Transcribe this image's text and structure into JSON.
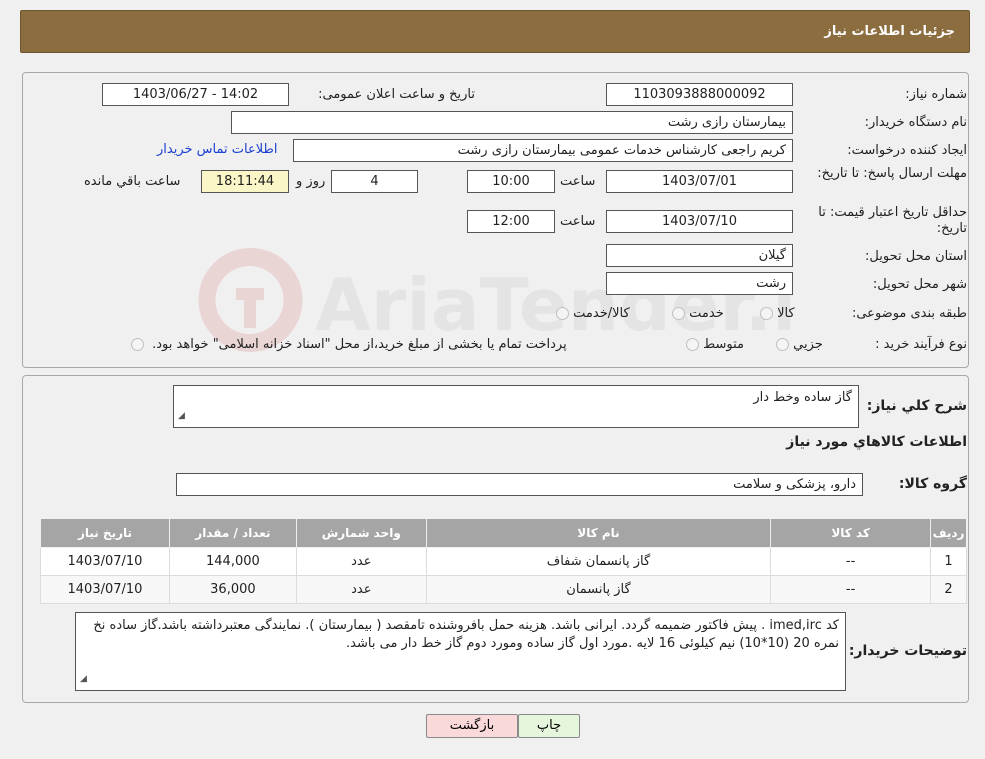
{
  "page_title": "جزئیات اطلاعات نیاز",
  "labels": {
    "need_number": "شماره نیاز:",
    "announce_datetime": "تاریخ و ساعت اعلان عمومی:",
    "buyer_org": "نام دستگاه خریدار:",
    "requester": "ایجاد کننده درخواست:",
    "contact_link": "اطلاعات تماس خریدار",
    "reply_deadline": "مهلت ارسال پاسخ: تا تاریخ:",
    "time_word": "ساعت",
    "day_and": "روز و",
    "remaining": "ساعت باقي مانده",
    "price_validity": "حداقل تاریخ اعتبار قیمت: تا تاریخ:",
    "province": "استان محل تحویل:",
    "city": "شهر محل تحویل:",
    "category": "طبقه بندی موضوعی:",
    "process_type": "نوع فرآیند خرید :",
    "summary": "شرح كلي نياز:",
    "goods_info_heading": "اطلاعات كالاهاي مورد نياز",
    "goods_group": "گروه كالا:",
    "buyer_notes": "توضیحات خریدار:"
  },
  "fields": {
    "need_number": "1103093888000092",
    "announce_datetime": "1403/06/27 - 14:02",
    "buyer_org": "بیمارستان رازی رشت",
    "requester": "کریم راجعی کارشناس خدمات عمومی بیمارستان رازی رشت",
    "reply_date": "1403/07/01",
    "reply_time": "10:00",
    "days_left": "4",
    "time_left": "18:11:44",
    "validity_date": "1403/07/10",
    "validity_time": "12:00",
    "province": "گیلان",
    "city": "رشت",
    "summary": "گاز ساده وخط دار",
    "goods_group": "دارو، پزشکی و سلامت",
    "buyer_notes": "کد imed,irc . پیش فاکتور ضمیمه گردد. ایرانی باشد. هزینه حمل بافروشنده تامقصد ( بیمارستان ). نمایندگی معتبرداشته باشد.گاز ساده نخ نمره 20 (10*10) نیم کیلوئی 16 لایه .مورد اول گاز ساده ومورد دوم گاز خط دار می باشد."
  },
  "category_options": [
    "كالا",
    "خدمت",
    "كالا/خدمت"
  ],
  "process_options": [
    "جزيي",
    "متوسط"
  ],
  "process_note": "پرداخت تمام یا بخشی از مبلغ خرید،از محل \"اسناد خزانه اسلامی\" خواهد بود.",
  "table": {
    "headers": [
      "رديف",
      "كد كالا",
      "نام كالا",
      "واحد شمارش",
      "تعداد / مقدار",
      "تاریخ نیاز"
    ],
    "rows": [
      [
        "1",
        "--",
        "گاز پانسمان شفاف",
        "عدد",
        "144,000",
        "1403/07/10"
      ],
      [
        "2",
        "--",
        "گاز پانسمان",
        "عدد",
        "36,000",
        "1403/07/10"
      ]
    ]
  },
  "buttons": {
    "print": "چاپ",
    "back": "بازگشت"
  },
  "watermark_text": "AriaTender.neT",
  "colors": {
    "header": "#8c6d3f",
    "table_header": "#a5a5a5",
    "back_button": "#f9d9d9",
    "print_button": "#e6f6dc"
  }
}
